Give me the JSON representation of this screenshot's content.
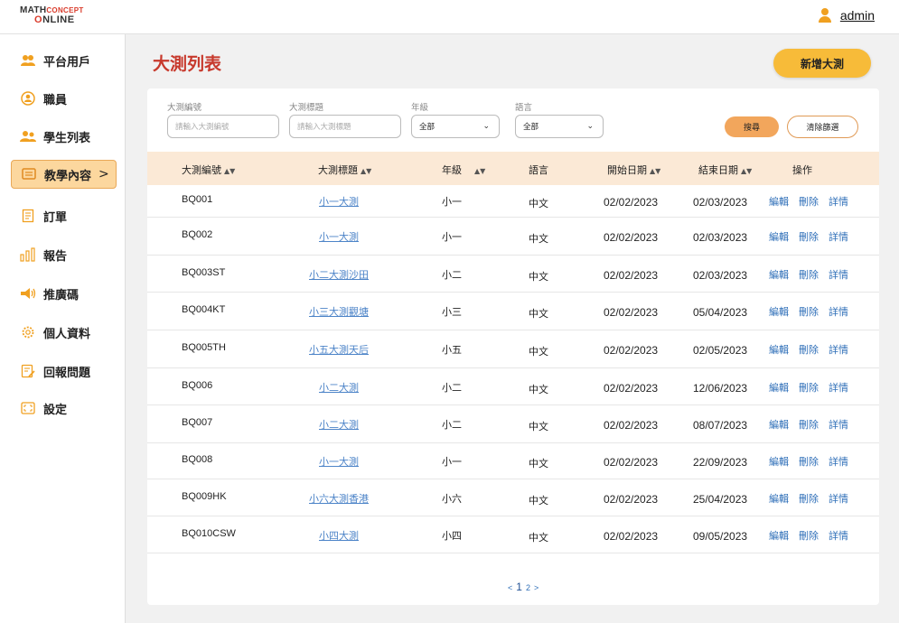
{
  "header": {
    "logo_line1_a": "MATH",
    "logo_line1_b": "CONCEPT",
    "logo_line2_a": "O",
    "logo_line2_b": "NLINE",
    "user_name": "admin"
  },
  "sidebar": {
    "items": [
      {
        "label": "平台用戶",
        "icon": "users-icon"
      },
      {
        "label": "職員",
        "icon": "staff-icon"
      },
      {
        "label": "學生列表",
        "icon": "students-icon"
      },
      {
        "label": "教學內容",
        "icon": "book-icon",
        "active": true
      },
      {
        "label": "訂單",
        "icon": "receipt-icon"
      },
      {
        "label": "報告",
        "icon": "bar-chart-icon"
      },
      {
        "label": "推廣碼",
        "icon": "megaphone-icon"
      },
      {
        "label": "個人資料",
        "icon": "gear-icon"
      },
      {
        "label": "回報問題",
        "icon": "report-icon"
      },
      {
        "label": "設定",
        "icon": "settings-frame-icon"
      }
    ]
  },
  "page": {
    "title": "大測列表",
    "add_button": "新增大測"
  },
  "filters": {
    "id_label": "大測編號",
    "id_placeholder": "請輸入大測編號",
    "title_label": "大測標題",
    "title_placeholder": "請輸入大測標題",
    "grade_label": "年級",
    "grade_value": "全部",
    "language_label": "語言",
    "language_value": "全部",
    "search_button": "搜尋",
    "clear_button": "清除篩選"
  },
  "table": {
    "headers": {
      "id": "大測編號",
      "title": "大測標題",
      "grade": "年級",
      "language": "語言",
      "start": "開始日期",
      "end": "結束日期",
      "actions": "操作"
    },
    "action_labels": {
      "edit": "編輯",
      "delete": "刪除",
      "details": "詳情"
    },
    "rows": [
      {
        "id": "BQ001",
        "title": "小一大測",
        "grade": "小一",
        "language": "中文",
        "start": "02/02/2023",
        "end": "02/03/2023"
      },
      {
        "id": "BQ002",
        "title": "小一大測",
        "grade": "小一",
        "language": "中文",
        "start": "02/02/2023",
        "end": "02/03/2023"
      },
      {
        "id": "BQ003ST",
        "title": "小二大測沙田",
        "grade": "小二",
        "language": "中文",
        "start": "02/02/2023",
        "end": "02/03/2023"
      },
      {
        "id": "BQ004KT",
        "title": "小三大測觀塘",
        "grade": "小三",
        "language": "中文",
        "start": "02/02/2023",
        "end": "05/04/2023"
      },
      {
        "id": "BQ005TH",
        "title": "小五大測天后",
        "grade": "小五",
        "language": "中文",
        "start": "02/02/2023",
        "end": "02/05/2023"
      },
      {
        "id": "BQ006",
        "title": "小二大測",
        "grade": "小二",
        "language": "中文",
        "start": "02/02/2023",
        "end": "12/06/2023"
      },
      {
        "id": "BQ007",
        "title": "小二大測",
        "grade": "小二",
        "language": "中文",
        "start": "02/02/2023",
        "end": "08/07/2023"
      },
      {
        "id": "BQ008",
        "title": "小一大測",
        "grade": "小一",
        "language": "中文",
        "start": "02/02/2023",
        "end": "22/09/2023"
      },
      {
        "id": "BQ009HK",
        "title": "小六大測香港",
        "grade": "小六",
        "language": "中文",
        "start": "02/02/2023",
        "end": "25/04/2023"
      },
      {
        "id": "BQ010CSW",
        "title": "小四大測",
        "grade": "小四",
        "language": "中文",
        "start": "02/02/2023",
        "end": "09/05/2023"
      }
    ]
  },
  "pagination": {
    "prev": "<",
    "current": "1",
    "page2": "2",
    "next": ">"
  }
}
